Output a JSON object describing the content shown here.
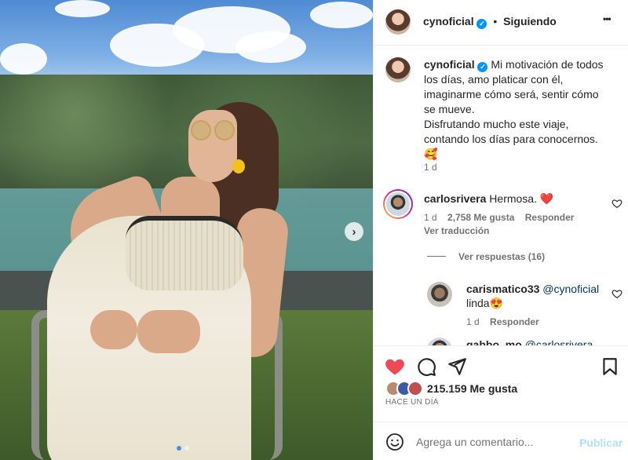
{
  "post": {
    "username": "cynoficial",
    "follow_status": "Siguiendo",
    "separator": "•",
    "more_label": "•••",
    "caption_lines": [
      "Mi motivación de todos",
      "los días, amo platicar con él,",
      "imaginarme cómo será, sentir cómo",
      "se mueve.",
      "Disfrutando mucho este viaje,",
      "contando los días para conocernos.",
      "🥰"
    ],
    "caption_time": "1 d"
  },
  "comments": [
    {
      "username": "carlosrivera",
      "text": "Hermosa. ❤️",
      "time": "1 d",
      "likes": "2,758 Me gusta",
      "reply_label": "Responder",
      "translate_label": "Ver traducción",
      "view_replies": "Ver respuestas (16)"
    },
    {
      "username": "carismatico33",
      "mention": "@cynoficial",
      "text": "linda😍",
      "time": "1 d",
      "reply_label": "Responder"
    },
    {
      "username": "gabbo_mo",
      "mention": "@carlosrivera"
    }
  ],
  "actions": {
    "likes_count": "215.159 Me gusta",
    "timestamp": "HACE UN DÍA"
  },
  "comment_box": {
    "placeholder": "Agrega un comentario...",
    "publish_label": "Publicar"
  },
  "colors": {
    "like_red": "#ed4956",
    "verified_blue": "#0095f6",
    "publish_disabled": "#b2dffc",
    "meta_gray": "#737373"
  },
  "icons": {
    "verified": "verified-badge-icon",
    "more": "more-options-icon",
    "like_filled": "heart-filled-icon",
    "comment": "comment-bubble-icon",
    "share": "paper-plane-icon",
    "save": "bookmark-icon",
    "emoji": "emoji-smiley-icon",
    "next": "chevron-right-icon",
    "comment_like": "heart-outline-icon"
  }
}
